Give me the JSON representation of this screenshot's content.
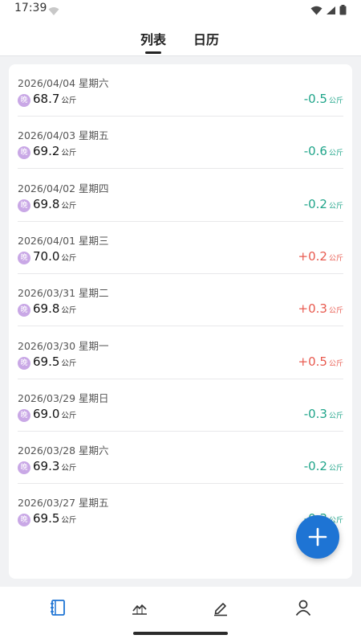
{
  "status_bar": {
    "time": "17:39"
  },
  "tabs": [
    {
      "label": "列表",
      "active": true
    },
    {
      "label": "日历",
      "active": false
    }
  ],
  "records": [
    {
      "date": "2026/04/04  星期六",
      "badge": "晚",
      "weight": "68.7",
      "weight_unit": "公斤",
      "diff": "-0.5",
      "diff_unit": "公斤",
      "trend": "down"
    },
    {
      "date": "2026/04/03  星期五",
      "badge": "晚",
      "weight": "69.2",
      "weight_unit": "公斤",
      "diff": "-0.6",
      "diff_unit": "公斤",
      "trend": "down"
    },
    {
      "date": "2026/04/02  星期四",
      "badge": "晚",
      "weight": "69.8",
      "weight_unit": "公斤",
      "diff": "-0.2",
      "diff_unit": "公斤",
      "trend": "down"
    },
    {
      "date": "2026/04/01  星期三",
      "badge": "晚",
      "weight": "70.0",
      "weight_unit": "公斤",
      "diff": "+0.2",
      "diff_unit": "公斤",
      "trend": "up"
    },
    {
      "date": "2026/03/31  星期二",
      "badge": "晚",
      "weight": "69.8",
      "weight_unit": "公斤",
      "diff": "+0.3",
      "diff_unit": "公斤",
      "trend": "up"
    },
    {
      "date": "2026/03/30  星期一",
      "badge": "晚",
      "weight": "69.5",
      "weight_unit": "公斤",
      "diff": "+0.5",
      "diff_unit": "公斤",
      "trend": "up"
    },
    {
      "date": "2026/03/29  星期日",
      "badge": "晚",
      "weight": "69.0",
      "weight_unit": "公斤",
      "diff": "-0.3",
      "diff_unit": "公斤",
      "trend": "down"
    },
    {
      "date": "2026/03/28  星期六",
      "badge": "晚",
      "weight": "69.3",
      "weight_unit": "公斤",
      "diff": "-0.2",
      "diff_unit": "公斤",
      "trend": "down"
    },
    {
      "date": "2026/03/27  星期五",
      "badge": "晚",
      "weight": "69.5",
      "weight_unit": "公斤",
      "diff": "-0.3",
      "diff_unit": "公斤",
      "trend": "down"
    }
  ],
  "fab": {
    "icon": "plus-icon"
  },
  "bottom_nav": [
    {
      "icon": "notebook-icon",
      "active": true
    },
    {
      "icon": "chart-icon",
      "active": false
    },
    {
      "icon": "pencil-icon",
      "active": false
    },
    {
      "icon": "profile-icon",
      "active": false
    }
  ],
  "colors": {
    "accent": "#1e74d4",
    "up": "#e85a4f",
    "down": "#20a58a",
    "badge": "#c9a8e6"
  }
}
